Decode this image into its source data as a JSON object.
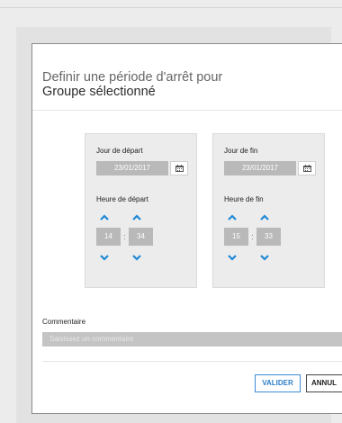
{
  "dialog": {
    "title_line1": "Definir une période d'arrêt pour",
    "title_line2": "Groupe sélectionné"
  },
  "start": {
    "date_label": "Jour de départ",
    "date_value": "23/01/2017",
    "time_label": "Heure de départ",
    "hour": "14",
    "minute": "34"
  },
  "end": {
    "date_label": "Jour de fin",
    "date_value": "23/01/2017",
    "time_label": "Heure de fin",
    "hour": "15",
    "minute": "33"
  },
  "time_separator": ":",
  "comment": {
    "label": "Commentaire",
    "placeholder": "Saisissez un commentaire"
  },
  "buttons": {
    "validate": "VALIDER",
    "cancel": "ANNUL"
  },
  "colors": {
    "accent": "#2f7fc9",
    "arrow": "#1e88d6"
  },
  "icons": [
    "calendar-icon",
    "chevron-up-icon",
    "chevron-down-icon"
  ]
}
